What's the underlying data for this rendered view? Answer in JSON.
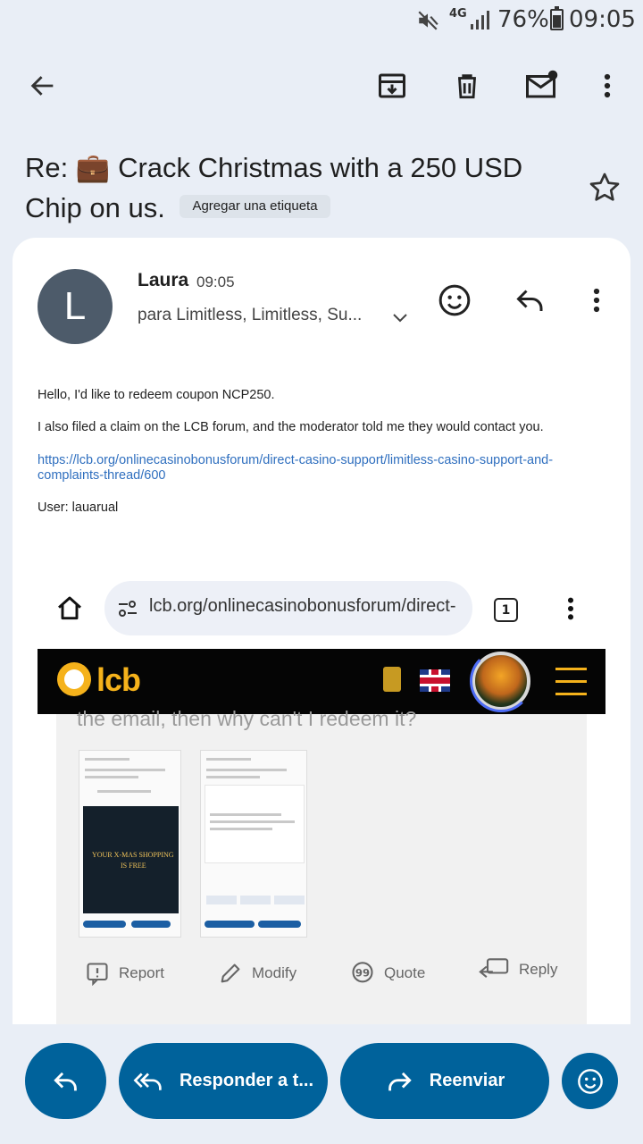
{
  "status_bar": {
    "network": "4G",
    "battery": "76%",
    "time": "09:05"
  },
  "toolbar": {
    "icons": [
      "back-arrow-icon",
      "archive-icon",
      "delete-icon",
      "mark-unread-icon",
      "more-vert-icon"
    ]
  },
  "email": {
    "subject_prefix": "Re: ",
    "subject_emoji": "💼",
    "subject_rest": " Crack Christmas with a 250 USD Chip on us.",
    "label_chip": "Agregar una etiqueta",
    "sender": {
      "initial": "L",
      "name": "Laura",
      "time": "09:05",
      "recipients": "para Limitless, Limitless, Su..."
    },
    "body": {
      "line1": "Hello, I'd like to redeem coupon NCP250.",
      "line2": "I also filed a claim on the LCB forum, and the moderator told me they would contact you.",
      "link": "https://lcb.org/onlinecasinobonusforum/direct-casino-support/limitless-casino-support-and-complaints-thread/600",
      "user_line": "User: lauarual"
    },
    "attachment": {
      "url": "lcb.org/onlinecasinobonusforum/direct-",
      "tab_count": "1",
      "site_logo": "lcb",
      "cut_text": "the email, then why can't I redeem it?",
      "forum_actions": {
        "report": "Report",
        "modify": "Modify",
        "quote": "Quote",
        "reply": "Reply"
      }
    }
  },
  "bottom_bar": {
    "reply_all": "Responder a t...",
    "forward": "Reenviar"
  },
  "colors": {
    "accent": "#00629b",
    "background": "#e9eef6",
    "link": "#2f6fbf",
    "lcb_gold": "#f5b21b"
  }
}
